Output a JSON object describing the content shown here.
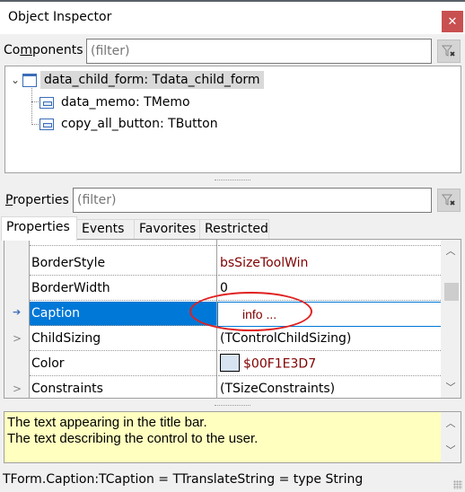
{
  "window": {
    "title": "Object Inspector",
    "close_icon": "close-icon"
  },
  "components": {
    "label_pre": "Co",
    "label_accel": "m",
    "label_post": "ponents",
    "filter_placeholder": "(filter)",
    "filter_clear_icon": "filter-clear-icon",
    "tree": [
      {
        "label": "data_child_form: Tdata_child_form",
        "icon": "form-icon",
        "expanded": true,
        "selected": true
      },
      {
        "label": "data_memo: TMemo",
        "icon": "control-icon"
      },
      {
        "label": "copy_all_button: TButton",
        "icon": "control-icon"
      }
    ]
  },
  "properties": {
    "label_accel": "P",
    "label_post": "roperties",
    "filter_placeholder": "(filter)",
    "tabs": [
      {
        "label": "Properties",
        "active": true
      },
      {
        "label": "Events"
      },
      {
        "label": "Favorites"
      },
      {
        "label": "Restricted"
      }
    ],
    "rows": [
      {
        "name": "BorderStyle",
        "value": "bsSizeToolWin",
        "value_color": "red"
      },
      {
        "name": "BorderWidth",
        "value": "0"
      },
      {
        "name": "Caption",
        "value": "info ...",
        "selected": true,
        "editing": true
      },
      {
        "name": "ChildSizing",
        "value": "(TControlChildSizing)",
        "expandable": true
      },
      {
        "name": "Color",
        "value": "$00F1E3D7",
        "value_color": "red",
        "swatch": "#d7e3f1"
      },
      {
        "name": "Constraints",
        "value": "(TSizeConstraints)",
        "expandable": true
      }
    ]
  },
  "description": {
    "lines": [
      "The text appearing in the title bar.",
      "The text describing the control to the user."
    ]
  },
  "status": {
    "text": "TForm.Caption:TCaption = TTranslateString = type String"
  },
  "colors": {
    "selection": "#0078d7",
    "close": "#c95050",
    "hint_bg": "#ffffc0",
    "value_red": "#800000",
    "annotation": "#e02020"
  }
}
